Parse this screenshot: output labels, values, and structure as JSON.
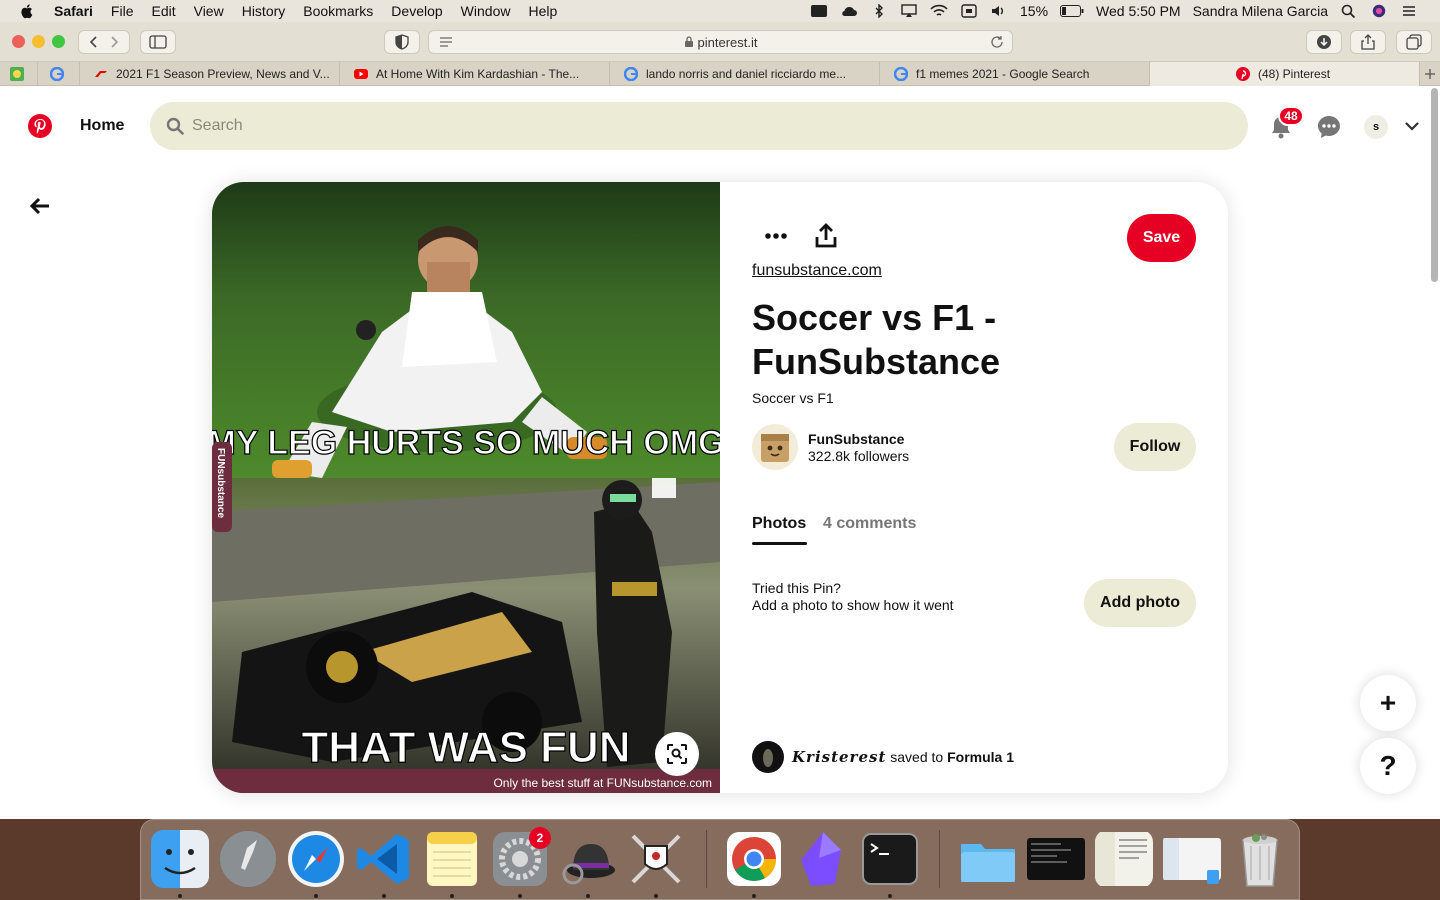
{
  "menubar": {
    "app": "Safari",
    "items": [
      "File",
      "Edit",
      "View",
      "History",
      "Bookmarks",
      "Develop",
      "Window",
      "Help"
    ],
    "battery": "15%",
    "clock": "Wed 5:50 PM",
    "user": "Sandra Milena Garcia"
  },
  "browser": {
    "url": "pinterest.it",
    "tabs": [
      {
        "title": "2021 F1 Season Preview, News and V...",
        "active": false
      },
      {
        "title": "At Home With Kim Kardashian - The...",
        "active": false
      },
      {
        "title": "lando norris and daniel ricciardo me...",
        "active": false
      },
      {
        "title": "f1 memes 2021 - Google Search",
        "active": false
      },
      {
        "title": "(48) Pinterest",
        "active": true
      }
    ]
  },
  "header": {
    "home_label": "Home",
    "search_placeholder": "Search",
    "notification_count": "48",
    "avatar_initial": "s"
  },
  "pin": {
    "image_text_top": "MY LEG HURTS SO MUCH OMG",
    "image_text_bottom": "THAT WAS FUN",
    "watermark_side": "FUNsubstance",
    "watermark_bottom": "Only the best stuff at FUNsubstance.com",
    "save_label": "Save",
    "source": "funsubstance.com",
    "title": "Soccer vs F1 - FunSubstance",
    "description": "Soccer vs F1",
    "creator_name": "FunSubstance",
    "creator_followers": "322.8k followers",
    "follow_label": "Follow",
    "tab_photos": "Photos",
    "tab_comments": "4 comments",
    "tried_title": "Tried this Pin?",
    "tried_sub": "Add a photo to show how it went",
    "add_photo_label": "Add photo",
    "saver": "Kristerest",
    "saved_to": "saved to",
    "board": "Formula 1"
  },
  "fab": {
    "plus": "+",
    "help": "?"
  },
  "dock": {
    "settings_badge": "2"
  },
  "colors": {
    "brand": "#e60023",
    "pill": "#ecebd6"
  }
}
